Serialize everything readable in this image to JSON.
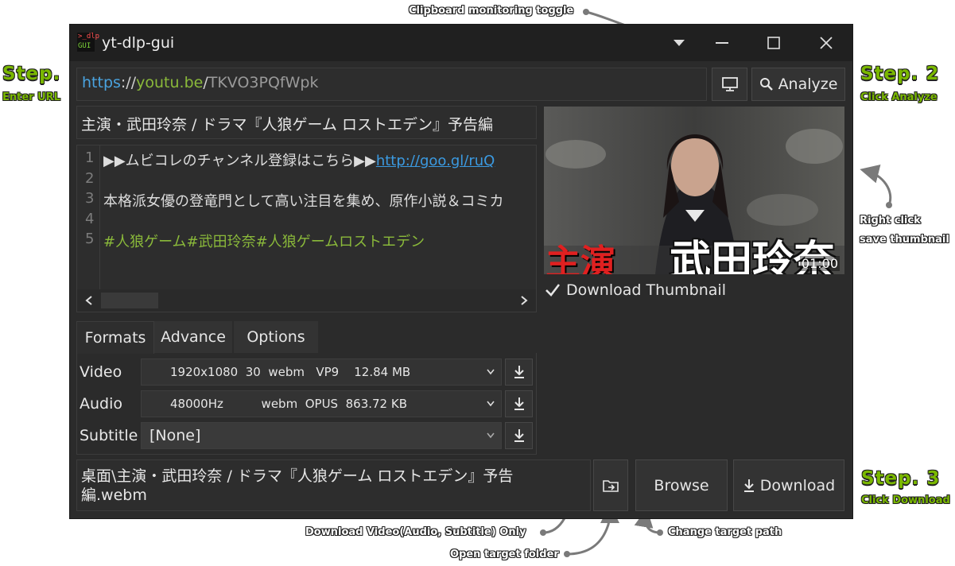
{
  "annotations": {
    "step1": {
      "title": "Step. 1",
      "sub": "Enter URL"
    },
    "step2": {
      "title": "Step. 2",
      "sub": "Click Analyze"
    },
    "step3": {
      "title": "Step. 3",
      "sub": "Click Download"
    },
    "clipboard": "Clipboard monitoring toggle",
    "right_click_1": "Right click",
    "right_click_2": "save thumbnail",
    "download_only": "Download Video(Audio, Subtitle) Only",
    "open_folder": "Open target folder",
    "change_path": "Change target path"
  },
  "window": {
    "icon_top": ">_dlp",
    "icon_bottom": "GUI",
    "title": "yt-dlp-gui",
    "controls": [
      "▾",
      "—",
      "☐",
      "✕"
    ]
  },
  "url": {
    "scheme": "https",
    "sep": "://",
    "host": "youtu.be",
    "slash": "/",
    "id": "TKVO3PQfWpk"
  },
  "buttons": {
    "analyze": "Analyze",
    "browse": "Browse",
    "download": "Download"
  },
  "video_title": "主演・武田玲奈 / ドラマ『人狼ゲーム ロストエデン』予告編",
  "description": {
    "line_numbers": [
      "1",
      "2",
      "3",
      "4",
      "5"
    ],
    "line1_text": "▶▶ムビコレのチャンネル登録はこちら▶▶",
    "line1_link": "http://goo.gl/ruQ",
    "line3": "本格派女優の登竜門として高い注目を集め、原作小説＆コミカ",
    "line5": "#人狼ゲーム#武田玲奈#人狼ゲームロストエデン"
  },
  "thumbnail": {
    "overlay_red": "主演",
    "overlay_white": "武田玲奈",
    "duration": "01:00"
  },
  "download_thumbnail": {
    "label": "Download Thumbnail",
    "checked": true
  },
  "tabs": [
    "Formats",
    "Advance",
    "Options"
  ],
  "formats": {
    "video_label": "Video",
    "video_value": "1920x1080  30  webm   VP9    12.84 MB",
    "audio_label": "Audio",
    "audio_value": "48000Hz          webm  OPUS  863.72 KB",
    "subtitle_label": "Subtitle",
    "subtitle_value": "[None]"
  },
  "target_path": {
    "line1": "桌面\\主演・武田玲奈 / ドラマ『人狼ゲーム ロストエデン』予告",
    "line2": "編.webm"
  },
  "colors": {
    "annotation_green": "#7ab800",
    "link_blue": "#3b9ae1",
    "url_scheme": "#4aa3df",
    "url_host": "#8ab93a",
    "hashtag_green": "#8ab93a"
  }
}
